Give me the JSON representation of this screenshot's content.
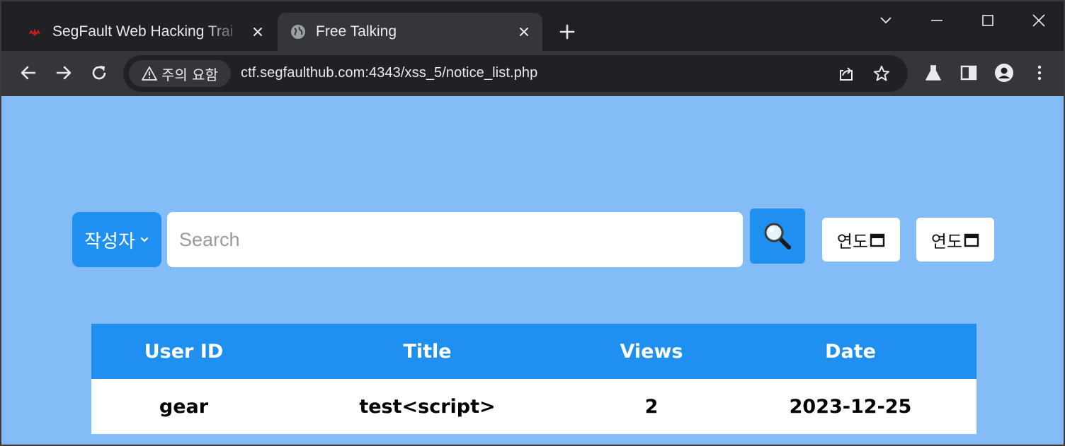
{
  "browser": {
    "tabs": [
      {
        "title": "SegFault Web Hacking Trai",
        "active": false,
        "icon": "segfault-favicon"
      },
      {
        "title": "Free Talking",
        "active": true,
        "icon": "globe-icon"
      }
    ],
    "security_chip": "주의 요함",
    "url": "ctf.segfaulthub.com:4343/xss_5/notice_list.php"
  },
  "search": {
    "filter_selected": "작성자",
    "placeholder": "Search",
    "start_date_placeholder": "연도",
    "end_date_placeholder": "연도"
  },
  "table": {
    "headers": [
      "User ID",
      "Title",
      "Views",
      "Date"
    ],
    "rows": [
      {
        "user_id": "gear",
        "title": "test<script>",
        "views": "2",
        "date": "2023-12-25"
      }
    ]
  },
  "colors": {
    "page_background": "#83bcf6",
    "accent": "#1f8ff0",
    "tab_bar": "#202124",
    "toolbar": "#35363a"
  }
}
